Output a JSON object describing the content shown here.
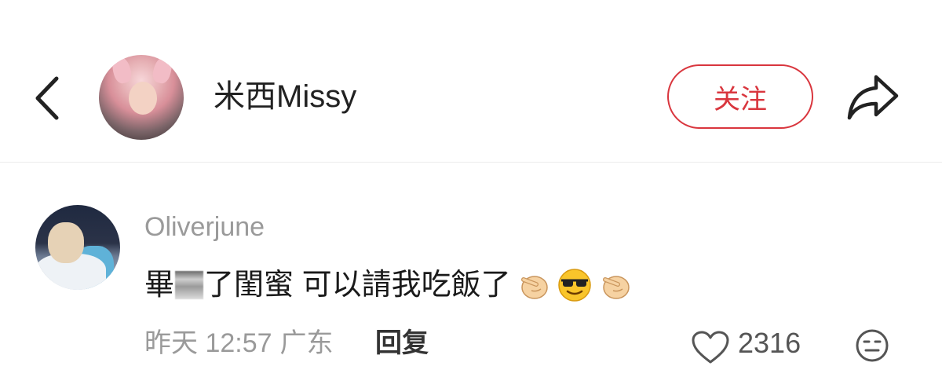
{
  "header": {
    "author_name": "米西Missy",
    "follow_label": "关注",
    "colors": {
      "accent": "#d9363e"
    }
  },
  "comment": {
    "username": "Oliverjune",
    "text_part1": "畢",
    "text_part2": "了閨蜜 可以請我吃飯了",
    "emojis": [
      "point-emoji",
      "sunglasses-emoji",
      "point-emoji"
    ],
    "time": "昨天 12:57",
    "location": "广东",
    "reply_label": "回复",
    "like_count": "2316"
  }
}
